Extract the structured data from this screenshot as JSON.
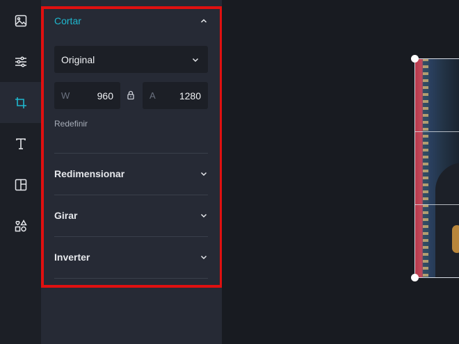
{
  "rail": {
    "items": [
      {
        "icon": "image-icon",
        "active": false
      },
      {
        "icon": "sliders-icon",
        "active": false
      },
      {
        "icon": "crop-icon",
        "active": true
      },
      {
        "icon": "text-icon",
        "active": false
      },
      {
        "icon": "layout-icon",
        "active": false
      },
      {
        "icon": "shapes-icon",
        "active": false
      }
    ]
  },
  "panel": {
    "crop": {
      "title": "Cortar",
      "aspect_select": "Original",
      "width_prefix": "W",
      "width_value": "960",
      "height_prefix": "A",
      "height_value": "1280",
      "reset_label": "Redefinir"
    },
    "sections": [
      {
        "title": "Redimensionar"
      },
      {
        "title": "Girar"
      },
      {
        "title": "Inverter"
      }
    ]
  },
  "colors": {
    "accent": "#1fb8cf",
    "highlight_border": "#e01010",
    "panel_bg": "#262a35",
    "canvas_bg": "#181b21"
  }
}
